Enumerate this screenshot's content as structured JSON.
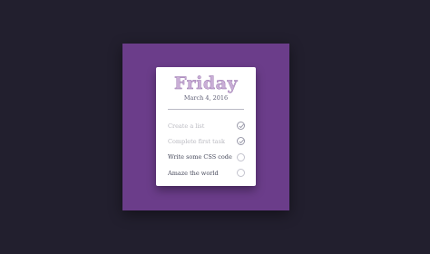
{
  "card": {
    "day": "Friday",
    "date": "March 4, 2016"
  },
  "tasks": [
    {
      "label": "Create a list",
      "completed": true
    },
    {
      "label": "Complete first task",
      "completed": true
    },
    {
      "label": "Write some CSS code",
      "completed": false
    },
    {
      "label": "Amaze the world",
      "completed": false
    }
  ],
  "colors": {
    "page_background": "#221f2e",
    "frame_background": "#6b3d8a",
    "card_background": "#ffffff",
    "title_color": "#c9aed6",
    "task_text": "#45485a",
    "task_done_text": "#b9b9c0"
  },
  "icons": {
    "completed": "checkmark-icon",
    "pending": "empty-circle-icon"
  }
}
